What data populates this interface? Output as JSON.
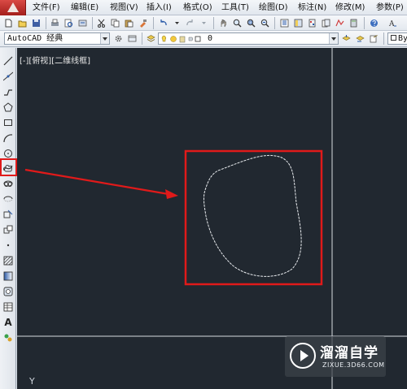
{
  "menu": {
    "items": [
      "文件(F)",
      "编辑(E)",
      "视图(V)",
      "插入(I)",
      "格式(O)",
      "工具(T)",
      "绘图(D)",
      "标注(N)",
      "修改(M)",
      "参数(P)"
    ]
  },
  "toolbar1": {
    "icons": [
      "new-icon",
      "open-icon",
      "save-icon",
      "print-icon",
      "plot-preview-icon",
      "publish-icon",
      "cut-icon",
      "copy-icon",
      "paste-icon",
      "match-properties-icon",
      "undo-icon",
      "redo-icon",
      "pan-icon",
      "zoom-realtime-icon",
      "zoom-window-icon",
      "zoom-previous-icon",
      "properties-icon",
      "design-center-icon",
      "tool-palettes-icon",
      "sheet-set-icon",
      "text-style-icon"
    ]
  },
  "toolbar2": {
    "workspace_value": "AutoCAD 经典",
    "layer_value": "0",
    "bylayer_value": "By"
  },
  "palette": {
    "tools": [
      "line-icon",
      "construction-line-icon",
      "polyline-icon",
      "polygon-icon",
      "rectangle-icon",
      "arc-icon",
      "circle-icon",
      "revision-cloud-icon",
      "spline-icon",
      "ellipse-icon",
      "ellipse-arc-icon",
      "insert-block-icon",
      "make-block-icon",
      "point-icon",
      "hatch-icon",
      "gradient-icon",
      "region-icon",
      "table-icon",
      "multiline-text-icon",
      "add-selected-icon"
    ],
    "text_tool_label": "A"
  },
  "canvas": {
    "viewport_label": "[-][俯视][二维线框]",
    "axis_label": "Y",
    "background_color": "#212830",
    "annotation_color": "#e01a1a"
  },
  "watermark": {
    "title": "溜溜自学",
    "url": "ZIXUE.3D66.COM"
  }
}
